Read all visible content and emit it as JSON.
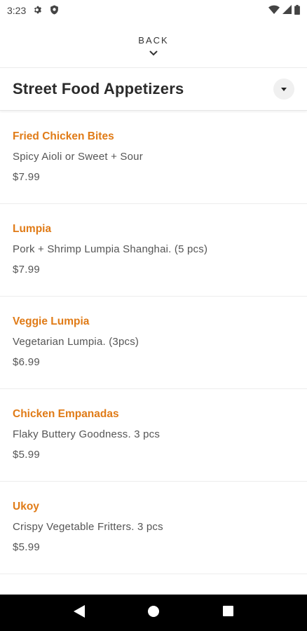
{
  "status_bar": {
    "time": "3:23",
    "icons": [
      "gear-icon",
      "shield-icon",
      "wifi-icon",
      "signal-icon",
      "battery-icon"
    ]
  },
  "back": {
    "label": "BACK"
  },
  "header": {
    "title": "Street Food Appetizers"
  },
  "colors": {
    "accent": "#e07b17",
    "text": "#555555",
    "title": "#2b2b2b"
  },
  "menu_items": [
    {
      "name": "Fried Chicken Bites",
      "description": "Spicy Aioli or Sweet + Sour",
      "price": "$7.99"
    },
    {
      "name": "Lumpia",
      "description": "Pork + Shrimp Lumpia Shanghai. (5 pcs)",
      "price": "$7.99"
    },
    {
      "name": "Veggie Lumpia",
      "description": "Vegetarian Lumpia. (3pcs)",
      "price": "$6.99"
    },
    {
      "name": "Chicken Empanadas",
      "description": "Flaky Buttery Goodness. 3 pcs",
      "price": "$5.99"
    },
    {
      "name": "Ukoy",
      "description": "Crispy Vegetable Fritters. 3 pcs",
      "price": "$5.99"
    }
  ],
  "nav_bar": {
    "icons": [
      "back-triangle-icon",
      "home-circle-icon",
      "recents-square-icon"
    ]
  }
}
